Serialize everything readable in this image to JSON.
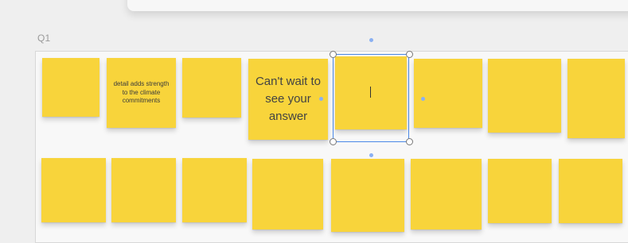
{
  "frame": {
    "label": "Q1"
  },
  "notes": {
    "detail_text": "detail adds strength to the climate commitments",
    "answer_text": "Can't wait to see your answer"
  },
  "colors": {
    "sticky": "#f8d43b",
    "selection": "#4b88e7",
    "canvas": "#efefef"
  },
  "icons": {
    "handles": "resize-handle-icon",
    "connectors": "connector-dot-icon",
    "cursor": "text-cursor-icon"
  }
}
